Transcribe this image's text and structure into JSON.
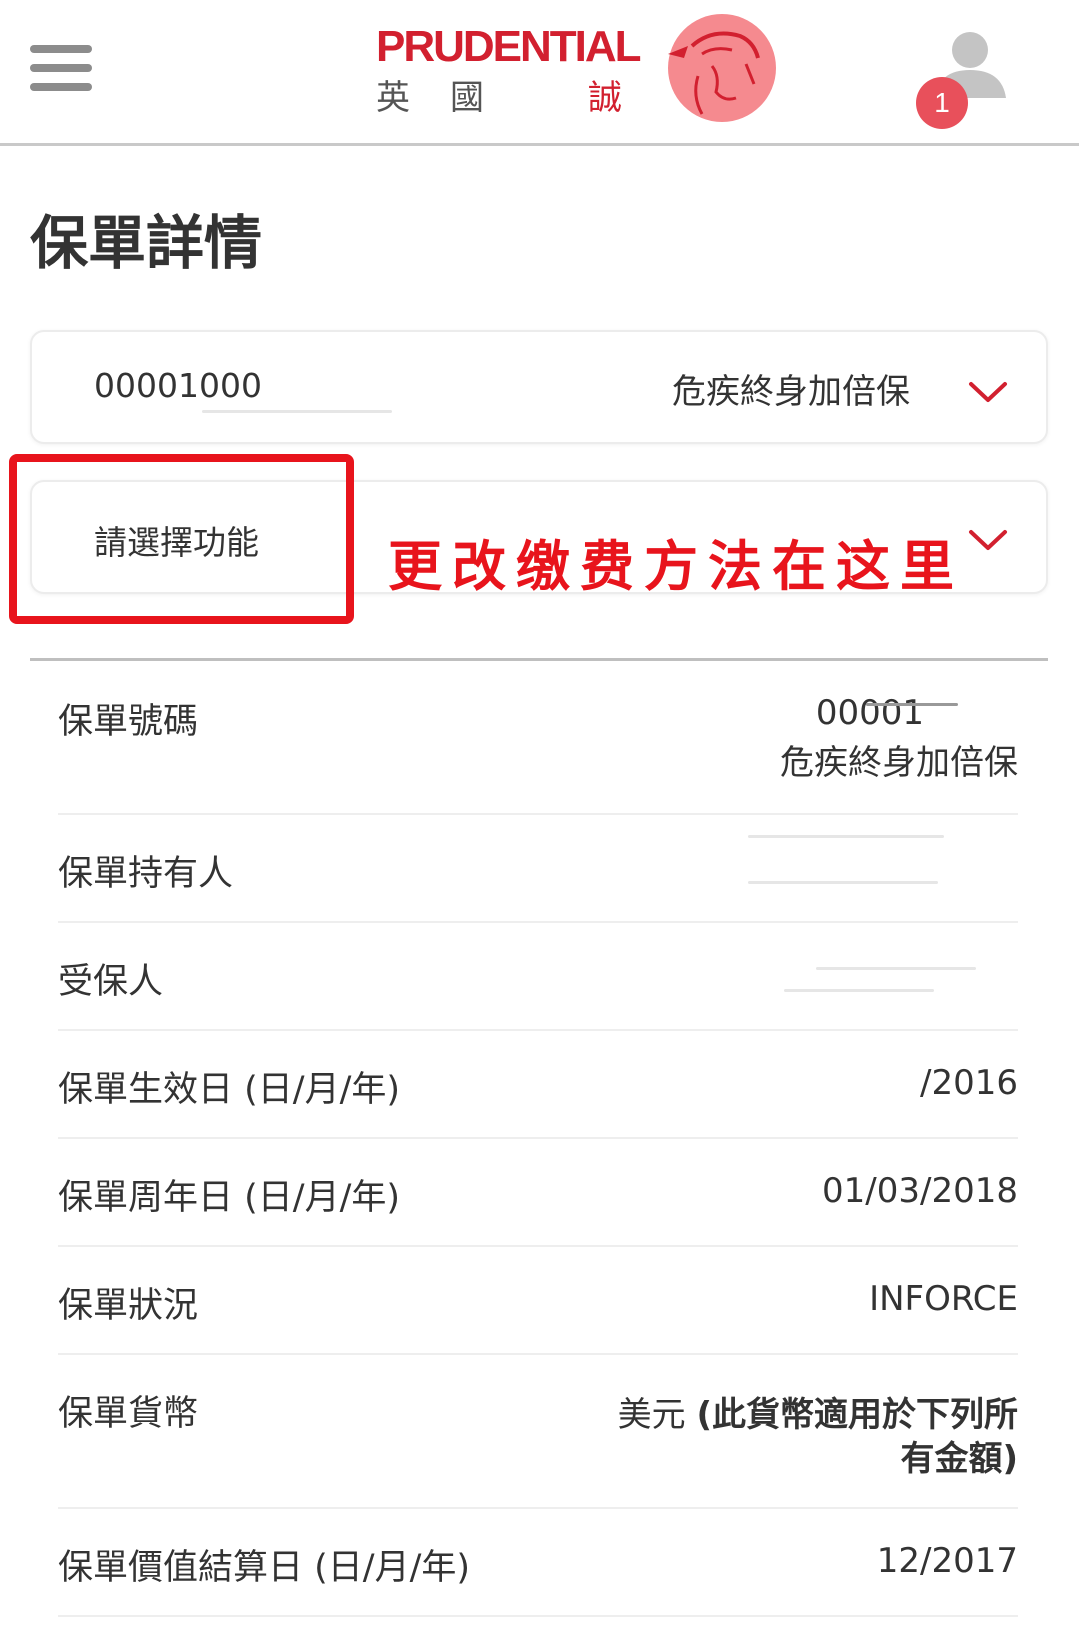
{
  "header": {
    "logo_text": "PRUDENTIAL",
    "logo_sub_1": "英",
    "logo_sub_2": "國",
    "logo_sub_3": "誠",
    "notification_count": "1",
    "brand_color": "#d2202f",
    "icons": [
      "menu-icon",
      "user-icon"
    ]
  },
  "page": {
    "title": "保單詳情"
  },
  "policy_selector": {
    "number": "00001000",
    "product": "危疾終身加倍保"
  },
  "function_selector": {
    "label": "請選擇功能"
  },
  "annotation": {
    "text": "更改缴费方法在这里",
    "color": "#e8141c"
  },
  "details": [
    {
      "label": "保單號碼",
      "value": "00001",
      "value_line2": "危疾終身加倍保"
    },
    {
      "label": "保單持有人",
      "value": ""
    },
    {
      "label": "受保人",
      "value": ""
    },
    {
      "label": "保單生效日 (日/月/年)",
      "value": "/2016"
    },
    {
      "label": "保單周年日 (日/月/年)",
      "value": "01/03/2018"
    },
    {
      "label": "保單狀況",
      "value": "INFORCE"
    },
    {
      "label": "保單貨幣",
      "value_prefix": "美元 ",
      "value_bold_1": "(此貨幣適用於下列所",
      "value_bold_2": "有金額)"
    },
    {
      "label": "保單價值結算日 (日/月/年)",
      "value": "12/2017"
    }
  ]
}
